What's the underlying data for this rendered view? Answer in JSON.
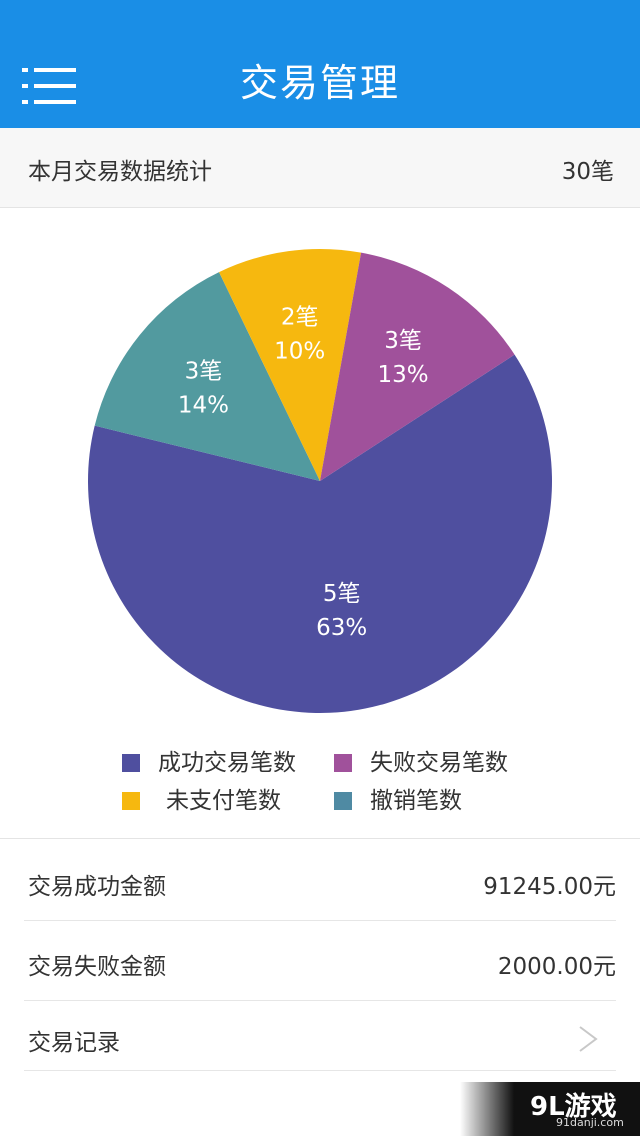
{
  "header": {
    "title": "交易管理"
  },
  "summary": {
    "label": "本月交易数据统计",
    "value": "30笔"
  },
  "chart_data": {
    "type": "pie",
    "slices": [
      {
        "key": "success",
        "count_label": "5笔",
        "pct_label": "63%",
        "value": 63,
        "color": "#4f4f9f"
      },
      {
        "key": "cancel",
        "count_label": "3笔",
        "pct_label": "14%",
        "value": 14,
        "color": "#529a9f"
      },
      {
        "key": "unpaid",
        "count_label": "2笔",
        "pct_label": "10%",
        "value": 10,
        "color": "#f6b80f"
      },
      {
        "key": "fail",
        "count_label": "3笔",
        "pct_label": "13%",
        "value": 13,
        "color": "#a0519b"
      }
    ],
    "legend": {
      "success": {
        "label": "成功交易笔数",
        "color": "#4f4f9f"
      },
      "fail": {
        "label": "失败交易笔数",
        "color": "#a0519b"
      },
      "unpaid": {
        "label": "未支付笔数",
        "color": "#f6b80f"
      },
      "cancel": {
        "label": "撤销笔数",
        "color": "#4f8aa3"
      }
    }
  },
  "rows": [
    {
      "label": "交易成功金额",
      "value": "91245.00元"
    },
    {
      "label": "交易失败金额",
      "value": "2000.00元"
    },
    {
      "label": "交易记录"
    }
  ],
  "watermark": {
    "main": "9L游戏",
    "sub": "91danji.com"
  },
  "icons": {
    "menu": "menu-icon",
    "chevron": "chevron-right-icon"
  }
}
